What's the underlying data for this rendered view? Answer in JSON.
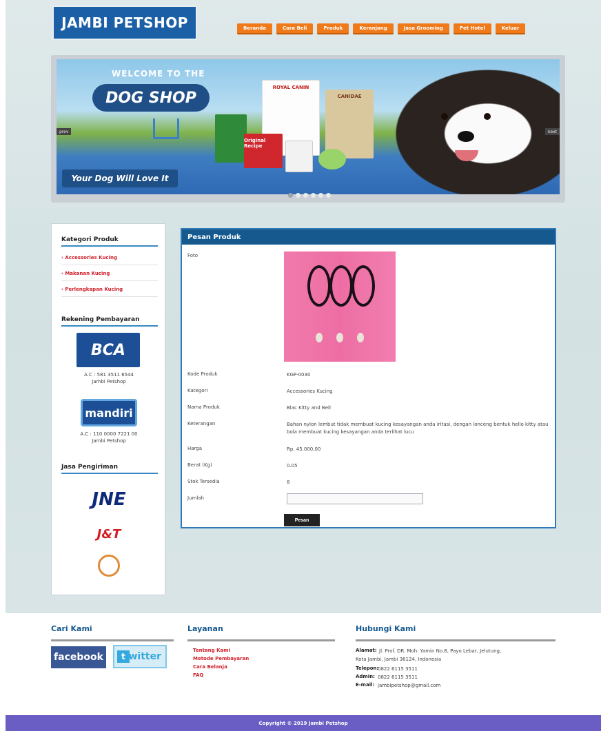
{
  "header": {
    "logo": "JAMBI PETSHOP",
    "nav": [
      "Beranda",
      "Cara Beli",
      "Produk",
      "Keranjang",
      "Jasa Grooming",
      "Pet Hotel",
      "Keluar"
    ]
  },
  "banner": {
    "welcome": "WELCOME TO THE",
    "shop_name": "DOG SHOP",
    "tagline": "Your Dog Will Love It",
    "prev": "prev",
    "next": "next",
    "product_labels": [
      "ROYAL CANIN",
      "CANIDAE",
      "Original Recipe"
    ]
  },
  "sidebar": {
    "categories_title": "Kategori Produk",
    "categories": [
      "Accessories Kucing",
      "Makanan Kucing",
      "Perlengkapan Kucing"
    ],
    "payment_title": "Rekening Pembayaran",
    "banks": [
      {
        "name": "BCA",
        "account": "A.C : 581 3511 6544",
        "holder": "Jambi Petshop"
      },
      {
        "name": "mandiri",
        "account": "A.C : 110 0000 7221 00",
        "holder": "Jambi Petshop"
      }
    ],
    "shipping_title": "Jasa Pengiriman",
    "couriers": [
      "JNE",
      "J&T",
      "POS INDONESIA"
    ]
  },
  "order": {
    "title": "Pesan Produk",
    "labels": {
      "photo": "Foto",
      "code": "Kode Produk",
      "category": "Kategori",
      "name": "Nama Produk",
      "description": "Keterangan",
      "price": "Harga",
      "weight": "Berat (Kg)",
      "stock": "Stok Tersedia",
      "qty": "Jumlah"
    },
    "values": {
      "code": "KGP-0030",
      "category": "Accessories Kucing",
      "name": "Blac Kitty and Bell",
      "description": "Bahan nylon lembut tidak membuat kucing kesayangan anda iritasi, dengan lonceng bentuk hello kitty atau bola membuat kucing kesayangan anda terlihat lucu",
      "price": "Rp. 45.000,00",
      "weight": "0.05",
      "stock": "8",
      "qty": ""
    },
    "submit_label": "Pesan"
  },
  "footer": {
    "find_title": "Cari Kami",
    "facebook": "facebook",
    "twitter": "twitter",
    "service_title": "Layanan",
    "services": [
      "Tentang Kami",
      "Metode Pembayaran",
      "Cara Belanja",
      "FAQ"
    ],
    "contact_title": "Hubungi Kami",
    "contact": {
      "address_label": "Alamat:",
      "address_1": "Jl. Prof. DR. Moh. Yamin No.8, Payo Lebar, Jelutung,",
      "address_2": "Kota Jambi, Jambi 36124, Indonesia",
      "phone_label": "Telepon:",
      "phone": "0822 6115 3511",
      "admin_label": "Admin:",
      "admin": "0822 6115 3511",
      "email_label": "E-mail:",
      "email": "jambipetshop@gmail.com"
    },
    "copyright": "Copyright © 2019 Jambi Petshop"
  },
  "colors": {
    "brand_blue": "#15598f",
    "nav_orange": "#f07a1a",
    "link_red": "#d0202a",
    "footer_bar": "#6a5ec4"
  }
}
